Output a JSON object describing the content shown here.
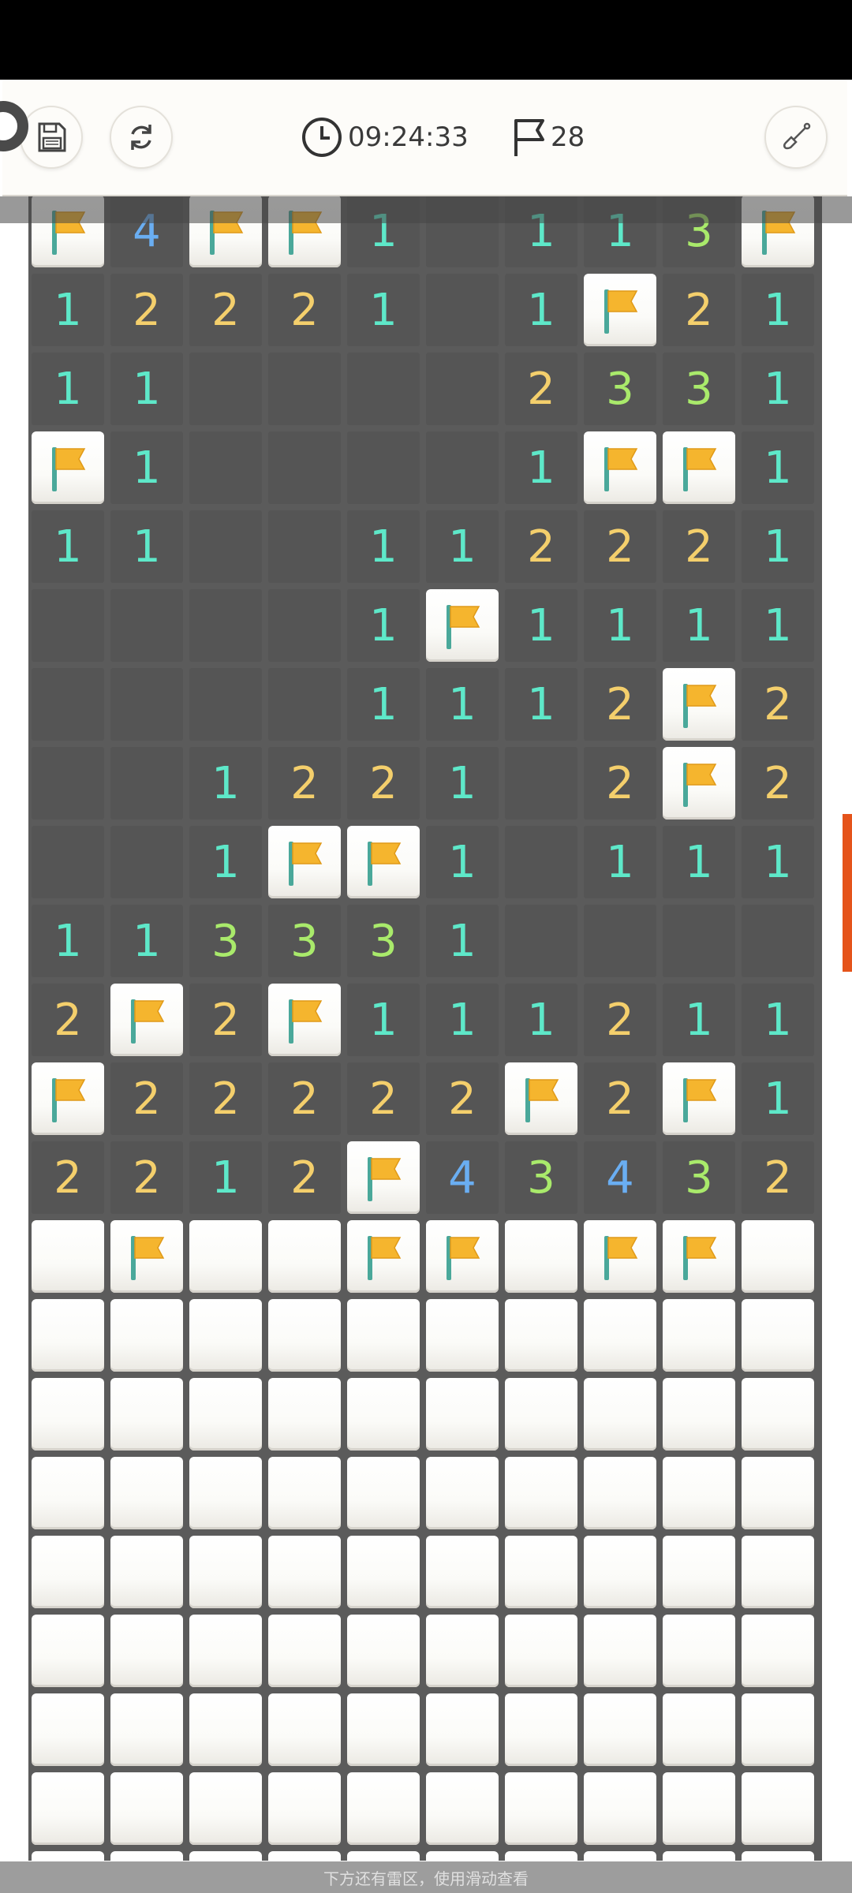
{
  "toolbar": {
    "timer": "09:24:33",
    "flags_remaining": "28"
  },
  "hint": "下方还有雷区，使用滑动查看",
  "board": [
    [
      "F",
      "4",
      "F",
      "F",
      "1",
      "",
      "1",
      "1",
      "3",
      "F"
    ],
    [
      "1",
      "2",
      "2",
      "2",
      "1",
      "",
      "1",
      "F",
      "2",
      "1"
    ],
    [
      "1",
      "1",
      "",
      "",
      "",
      "",
      "2",
      "3",
      "3",
      "1"
    ],
    [
      "F",
      "1",
      "",
      "",
      "",
      "",
      "1",
      "F",
      "F",
      "1"
    ],
    [
      "1",
      "1",
      "",
      "",
      "1",
      "1",
      "2",
      "2",
      "2",
      "1"
    ],
    [
      "",
      "",
      "",
      "",
      "1",
      "F",
      "1",
      "1",
      "1",
      "1"
    ],
    [
      "",
      "",
      "",
      "",
      "1",
      "1",
      "1",
      "2",
      "F",
      "2"
    ],
    [
      "",
      "",
      "1",
      "2",
      "2",
      "1",
      "",
      "2",
      "F",
      "2"
    ],
    [
      "",
      "",
      "1",
      "F",
      "F",
      "1",
      "",
      "1",
      "1",
      "1"
    ],
    [
      "1",
      "1",
      "3",
      "3",
      "3",
      "1",
      "",
      "",
      "",
      ""
    ],
    [
      "2",
      "F",
      "2",
      "F",
      "1",
      "1",
      "1",
      "2",
      "1",
      "1"
    ],
    [
      "F",
      "2",
      "2",
      "2",
      "2",
      "2",
      "F",
      "2",
      "F",
      "1"
    ],
    [
      "2",
      "2",
      "1",
      "2",
      "F",
      "4",
      "3",
      "4",
      "3",
      "2"
    ],
    [
      "C",
      "F",
      "C",
      "C",
      "F",
      "F",
      "C",
      "F",
      "F",
      "C"
    ],
    [
      "C",
      "C",
      "C",
      "C",
      "C",
      "C",
      "C",
      "C",
      "C",
      "C"
    ],
    [
      "C",
      "C",
      "C",
      "C",
      "C",
      "C",
      "C",
      "C",
      "C",
      "C"
    ],
    [
      "C",
      "C",
      "C",
      "C",
      "C",
      "C",
      "C",
      "C",
      "C",
      "C"
    ],
    [
      "C",
      "C",
      "C",
      "C",
      "C",
      "C",
      "C",
      "C",
      "C",
      "C"
    ],
    [
      "C",
      "C",
      "C",
      "C",
      "C",
      "C",
      "C",
      "C",
      "C",
      "C"
    ],
    [
      "C",
      "C",
      "C",
      "C",
      "C",
      "C",
      "C",
      "C",
      "C",
      "C"
    ],
    [
      "C",
      "C",
      "C",
      "C",
      "C",
      "C",
      "C",
      "C",
      "C",
      "C"
    ],
    [
      "C",
      "C",
      "C",
      "C",
      "C",
      "C",
      "C",
      "C",
      "C",
      "C"
    ]
  ],
  "colors": {
    "n1": "#5ee8c9",
    "n2": "#f4cf6c",
    "n3": "#a9ea6b",
    "n4": "#6aaef2",
    "flag": "#f5b52e",
    "pole": "#4aa89a",
    "revealed": "#555555",
    "grid": "#5b5b5b"
  },
  "icons": [
    "save-icon",
    "refresh-icon",
    "clock-icon",
    "flag-icon",
    "shovel-icon"
  ]
}
